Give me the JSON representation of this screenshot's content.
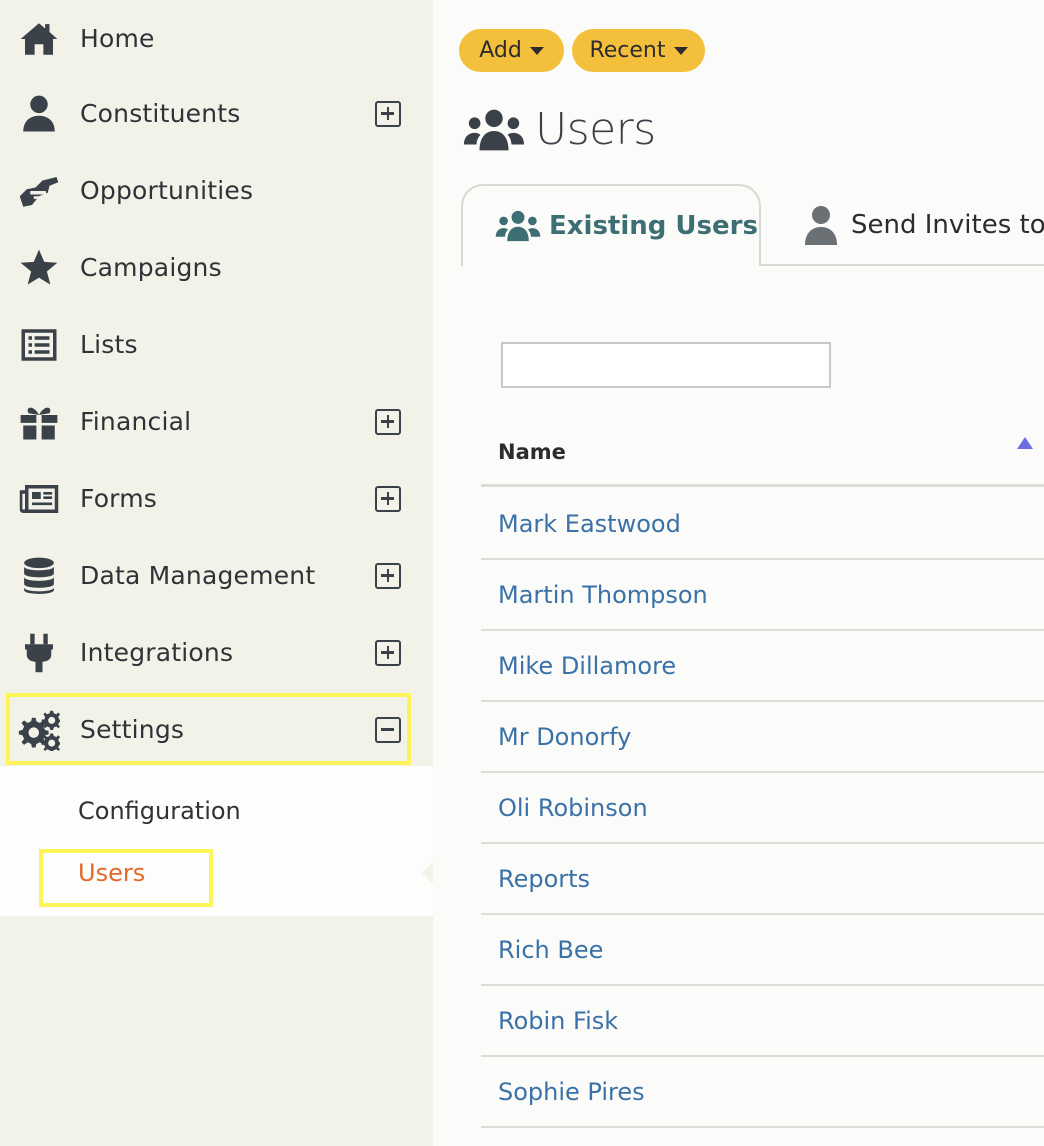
{
  "sidebar": {
    "items": [
      {
        "label": "Home",
        "icon": "home-icon",
        "expand": "none"
      },
      {
        "label": "Constituents",
        "icon": "user-icon",
        "expand": "plus"
      },
      {
        "label": "Opportunities",
        "icon": "handshake-icon",
        "expand": "none"
      },
      {
        "label": "Campaigns",
        "icon": "star-icon",
        "expand": "none"
      },
      {
        "label": "Lists",
        "icon": "list-icon",
        "expand": "none"
      },
      {
        "label": "Financial",
        "icon": "gift-icon",
        "expand": "plus"
      },
      {
        "label": "Forms",
        "icon": "newspaper-icon",
        "expand": "plus"
      },
      {
        "label": "Data Management",
        "icon": "database-icon",
        "expand": "plus"
      },
      {
        "label": "Integrations",
        "icon": "plug-icon",
        "expand": "plus"
      },
      {
        "label": "Settings",
        "icon": "cogs-icon",
        "expand": "minus"
      }
    ],
    "submenu": [
      {
        "label": "Configuration",
        "active": false
      },
      {
        "label": "Users",
        "active": true
      }
    ]
  },
  "toolbar": {
    "add_label": "Add",
    "recent_label": "Recent"
  },
  "page": {
    "title": "Users"
  },
  "tabs": [
    {
      "label": "Existing Users",
      "active": true
    },
    {
      "label": "Send Invites to",
      "active": false
    }
  ],
  "search": {
    "value": ""
  },
  "table": {
    "column_name": "Name",
    "sort": "ascending",
    "rows": [
      "Mark Eastwood",
      "Martin Thompson",
      "Mike Dillamore",
      "Mr Donorfy",
      "Oli Robinson",
      "Reports",
      "Rich Bee",
      "Robin Fisk",
      "Sophie Pires"
    ]
  },
  "colors": {
    "accent_button": "#f4c03c",
    "link": "#3a72a8",
    "active_submenu": "#e2682b",
    "tab_active": "#3d6e73",
    "highlight": "#fff35a"
  }
}
